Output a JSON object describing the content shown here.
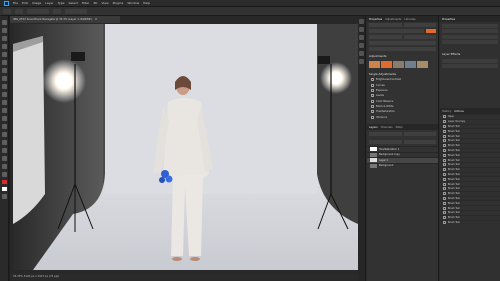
{
  "app": {
    "menu": [
      "File",
      "Edit",
      "Image",
      "Layer",
      "Type",
      "Select",
      "Filter",
      "3D",
      "View",
      "Plugins",
      "Window",
      "Help"
    ]
  },
  "document": {
    "tab_title": "IMG_0572 Soundtrack Navagate @ 33.3% (Layer 1, RGB/8#)",
    "zoom_status": "33.33%  5120 px x 3413 px (72 ppi)"
  },
  "panels": {
    "col_b_tabs": [
      "Properties",
      "Adjustments",
      "Libraries"
    ],
    "adjustments_title": "Adjustments",
    "adjustment_presets_title": "Single Adjustments",
    "adjustments": [
      "Brightness/Contrast",
      "Curves",
      "Exposure",
      "Levels",
      "Color Balance",
      "Black & White",
      "Hue/Saturation",
      "Vibrance"
    ],
    "layers_tabs": [
      "Layers",
      "Channels",
      "Paths"
    ],
    "layers": [
      "Hue/Saturation 1",
      "Background copy",
      "Layer 1",
      "Background"
    ],
    "col_c_tabs": [
      "Properties"
    ],
    "col_c_section": "Layer Effects",
    "history_tabs": [
      "History",
      "Actions"
    ],
    "history": [
      "Open",
      "Layer Via Copy",
      "Brush Tool",
      "Brush Tool",
      "Brush Tool",
      "Brush Tool",
      "Brush Tool",
      "Brush Tool",
      "Brush Tool",
      "Brush Tool",
      "Brush Tool",
      "Brush Tool",
      "Brush Tool",
      "Brush Tool",
      "Brush Tool",
      "Brush Tool",
      "Brush Tool",
      "Brush Tool",
      "Brush Tool",
      "Brush Tool",
      "Brush Tool",
      "Brush Tool",
      "Brush Tool"
    ]
  },
  "colors": {
    "accent_orange": "#e36a2d",
    "foreground_swatch": "#d32f2f",
    "background_swatch": "#ffffff"
  }
}
